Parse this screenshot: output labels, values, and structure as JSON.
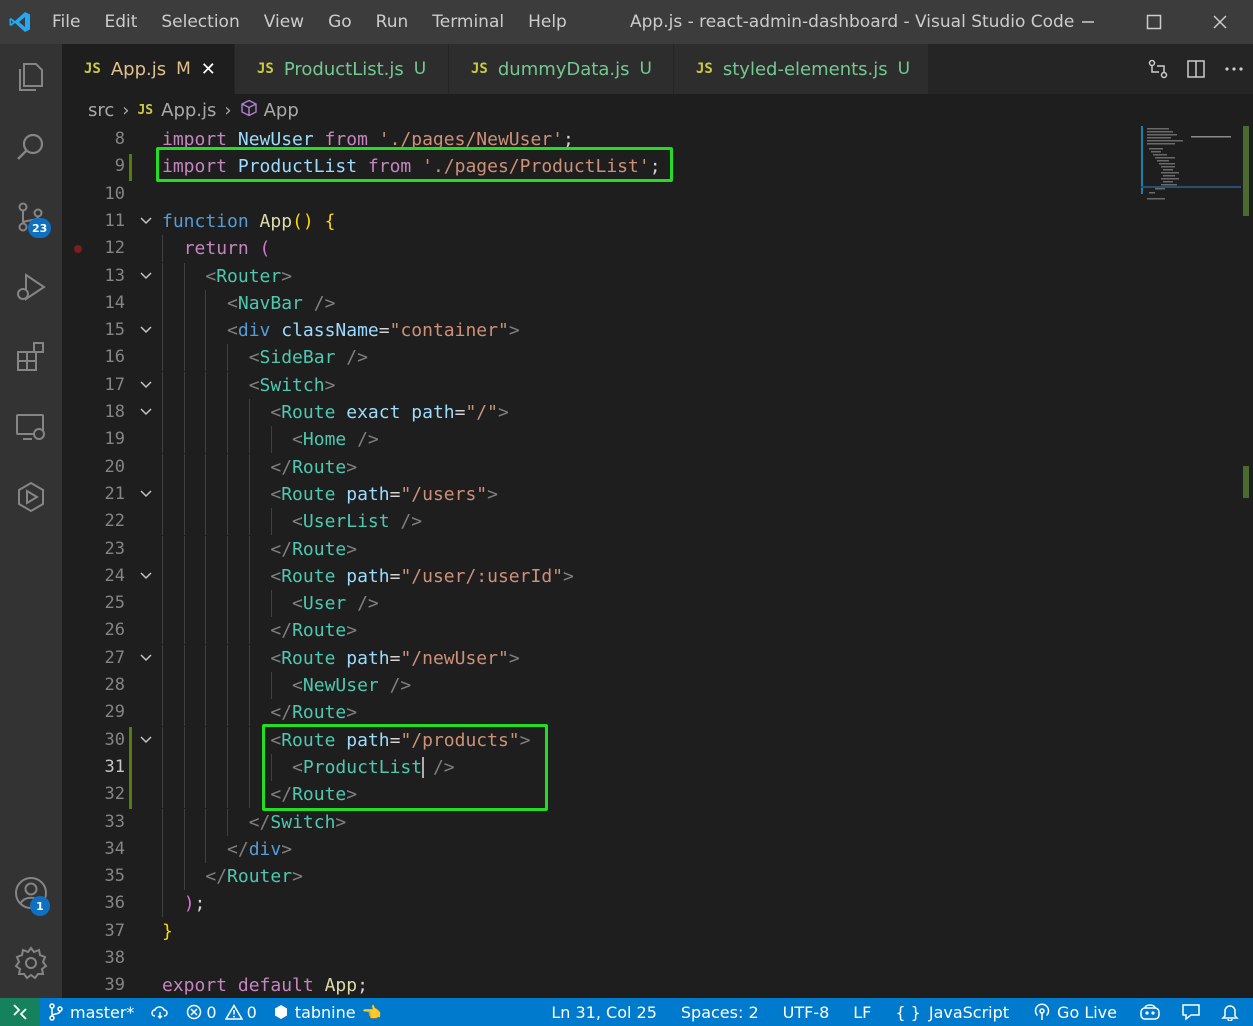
{
  "titlebar": {
    "menu": [
      "File",
      "Edit",
      "Selection",
      "View",
      "Go",
      "Run",
      "Terminal",
      "Help"
    ],
    "window_title": "App.js - react-admin-dashboard - Visual Studio Code"
  },
  "activitybar": {
    "source_control_badge": "23",
    "accounts_badge": "1"
  },
  "tabs": [
    {
      "icon": "JS",
      "name": "App.js",
      "status": "M",
      "active": true
    },
    {
      "icon": "JS",
      "name": "ProductList.js",
      "status": "U",
      "active": false
    },
    {
      "icon": "JS",
      "name": "dummyData.js",
      "status": "U",
      "active": false
    },
    {
      "icon": "JS",
      "name": "styled-elements.js",
      "status": "U",
      "active": false
    }
  ],
  "breadcrumb": {
    "folder": "src",
    "file_icon": "JS",
    "file": "App.js",
    "symbol": "App"
  },
  "editor": {
    "current_line": 31,
    "lines": [
      {
        "n": "8",
        "tokens": [
          [
            "kwc",
            "import "
          ],
          [
            "var",
            "NewUser"
          ],
          [
            "kwc",
            " from "
          ],
          [
            "str",
            "'./pages/NewUser'"
          ],
          [
            "plain",
            ";"
          ]
        ]
      },
      {
        "n": "9",
        "tokens": [
          [
            "kwc",
            "import "
          ],
          [
            "var",
            "ProductList"
          ],
          [
            "kwc",
            " from "
          ],
          [
            "str",
            "'./pages/ProductList'"
          ],
          [
            "plain",
            ";"
          ]
        ]
      },
      {
        "n": "10",
        "tokens": []
      },
      {
        "n": "11",
        "tokens": [
          [
            "kw",
            "function "
          ],
          [
            "fn",
            "App"
          ],
          [
            "brace",
            "() {"
          ]
        ]
      },
      {
        "n": "12",
        "tokens": [
          [
            "plain",
            "  "
          ],
          [
            "kwc",
            "return "
          ],
          [
            "brace2",
            "("
          ]
        ]
      },
      {
        "n": "13",
        "tokens": [
          [
            "plain",
            "    "
          ],
          [
            "punc",
            "<"
          ],
          [
            "tag",
            "Router"
          ],
          [
            "punc",
            ">"
          ]
        ]
      },
      {
        "n": "14",
        "tokens": [
          [
            "plain",
            "      "
          ],
          [
            "punc",
            "<"
          ],
          [
            "tag",
            "NavBar"
          ],
          [
            "punc",
            " />"
          ]
        ]
      },
      {
        "n": "15",
        "tokens": [
          [
            "plain",
            "      "
          ],
          [
            "punc",
            "<"
          ],
          [
            "kw",
            "div"
          ],
          [
            "attr",
            " className"
          ],
          [
            "plain",
            "="
          ],
          [
            "str",
            "\"container\""
          ],
          [
            "punc",
            ">"
          ]
        ]
      },
      {
        "n": "16",
        "tokens": [
          [
            "plain",
            "        "
          ],
          [
            "punc",
            "<"
          ],
          [
            "tag",
            "SideBar"
          ],
          [
            "punc",
            " />"
          ]
        ]
      },
      {
        "n": "17",
        "tokens": [
          [
            "plain",
            "        "
          ],
          [
            "punc",
            "<"
          ],
          [
            "tag",
            "Switch"
          ],
          [
            "punc",
            ">"
          ]
        ]
      },
      {
        "n": "18",
        "tokens": [
          [
            "plain",
            "          "
          ],
          [
            "punc",
            "<"
          ],
          [
            "tag",
            "Route"
          ],
          [
            "attr",
            " exact path"
          ],
          [
            "plain",
            "="
          ],
          [
            "str",
            "\"/\""
          ],
          [
            "punc",
            ">"
          ]
        ]
      },
      {
        "n": "19",
        "tokens": [
          [
            "plain",
            "            "
          ],
          [
            "punc",
            "<"
          ],
          [
            "tag",
            "Home"
          ],
          [
            "punc",
            " />"
          ]
        ]
      },
      {
        "n": "20",
        "tokens": [
          [
            "plain",
            "          "
          ],
          [
            "punc",
            "</"
          ],
          [
            "tag",
            "Route"
          ],
          [
            "punc",
            ">"
          ]
        ]
      },
      {
        "n": "21",
        "tokens": [
          [
            "plain",
            "          "
          ],
          [
            "punc",
            "<"
          ],
          [
            "tag",
            "Route"
          ],
          [
            "attr",
            " path"
          ],
          [
            "plain",
            "="
          ],
          [
            "str",
            "\"/users\""
          ],
          [
            "punc",
            ">"
          ]
        ]
      },
      {
        "n": "22",
        "tokens": [
          [
            "plain",
            "            "
          ],
          [
            "punc",
            "<"
          ],
          [
            "tag",
            "UserList"
          ],
          [
            "punc",
            " />"
          ]
        ]
      },
      {
        "n": "23",
        "tokens": [
          [
            "plain",
            "          "
          ],
          [
            "punc",
            "</"
          ],
          [
            "tag",
            "Route"
          ],
          [
            "punc",
            ">"
          ]
        ]
      },
      {
        "n": "24",
        "tokens": [
          [
            "plain",
            "          "
          ],
          [
            "punc",
            "<"
          ],
          [
            "tag",
            "Route"
          ],
          [
            "attr",
            " path"
          ],
          [
            "plain",
            "="
          ],
          [
            "str",
            "\"/user/:userId\""
          ],
          [
            "punc",
            ">"
          ]
        ]
      },
      {
        "n": "25",
        "tokens": [
          [
            "plain",
            "            "
          ],
          [
            "punc",
            "<"
          ],
          [
            "tag",
            "User"
          ],
          [
            "punc",
            " />"
          ]
        ]
      },
      {
        "n": "26",
        "tokens": [
          [
            "plain",
            "          "
          ],
          [
            "punc",
            "</"
          ],
          [
            "tag",
            "Route"
          ],
          [
            "punc",
            ">"
          ]
        ]
      },
      {
        "n": "27",
        "tokens": [
          [
            "plain",
            "          "
          ],
          [
            "punc",
            "<"
          ],
          [
            "tag",
            "Route"
          ],
          [
            "attr",
            " path"
          ],
          [
            "plain",
            "="
          ],
          [
            "str",
            "\"/newUser\""
          ],
          [
            "punc",
            ">"
          ]
        ]
      },
      {
        "n": "28",
        "tokens": [
          [
            "plain",
            "            "
          ],
          [
            "punc",
            "<"
          ],
          [
            "tag",
            "NewUser"
          ],
          [
            "punc",
            " />"
          ]
        ]
      },
      {
        "n": "29",
        "tokens": [
          [
            "plain",
            "          "
          ],
          [
            "punc",
            "</"
          ],
          [
            "tag",
            "Route"
          ],
          [
            "punc",
            ">"
          ]
        ]
      },
      {
        "n": "30",
        "tokens": [
          [
            "plain",
            "          "
          ],
          [
            "punc",
            "<"
          ],
          [
            "tag",
            "Route"
          ],
          [
            "attr",
            " path"
          ],
          [
            "plain",
            "="
          ],
          [
            "str",
            "\"/products\""
          ],
          [
            "punc",
            ">"
          ]
        ]
      },
      {
        "n": "31",
        "tokens": [
          [
            "plain",
            "            "
          ],
          [
            "punc",
            "<"
          ],
          [
            "tag",
            "ProductList"
          ],
          [
            "punc",
            " />"
          ]
        ]
      },
      {
        "n": "32",
        "tokens": [
          [
            "plain",
            "          "
          ],
          [
            "punc",
            "</"
          ],
          [
            "tag",
            "Route"
          ],
          [
            "punc",
            ">"
          ]
        ]
      },
      {
        "n": "33",
        "tokens": [
          [
            "plain",
            "        "
          ],
          [
            "punc",
            "</"
          ],
          [
            "tag",
            "Switch"
          ],
          [
            "punc",
            ">"
          ]
        ]
      },
      {
        "n": "34",
        "tokens": [
          [
            "plain",
            "      "
          ],
          [
            "punc",
            "</"
          ],
          [
            "kw",
            "div"
          ],
          [
            "punc",
            ">"
          ]
        ]
      },
      {
        "n": "35",
        "tokens": [
          [
            "plain",
            "    "
          ],
          [
            "punc",
            "</"
          ],
          [
            "tag",
            "Router"
          ],
          [
            "punc",
            ">"
          ]
        ]
      },
      {
        "n": "36",
        "tokens": [
          [
            "plain",
            "  "
          ],
          [
            "brace2",
            ")"
          ],
          [
            "plain",
            ";"
          ]
        ]
      },
      {
        "n": "37",
        "tokens": [
          [
            "brace",
            "}"
          ]
        ]
      },
      {
        "n": "38",
        "tokens": []
      },
      {
        "n": "39",
        "tokens": [
          [
            "kwc",
            "export default "
          ],
          [
            "fn",
            "App"
          ],
          [
            "plain",
            ";"
          ]
        ]
      }
    ]
  },
  "statusbar": {
    "branch": "master*",
    "errors": "0",
    "warnings": "0",
    "tabnine": "tabnine",
    "position": "Ln 31, Col 25",
    "spaces": "Spaces: 2",
    "encoding": "UTF-8",
    "eol": "LF",
    "language": "JavaScript",
    "golive": "Go Live"
  },
  "colors": {
    "highlight_box": "#22dd22",
    "statusbar": "#007acc",
    "titlebar": "#3c3c3c",
    "activitybar": "#333333",
    "editor_bg": "#1e1e1e"
  }
}
